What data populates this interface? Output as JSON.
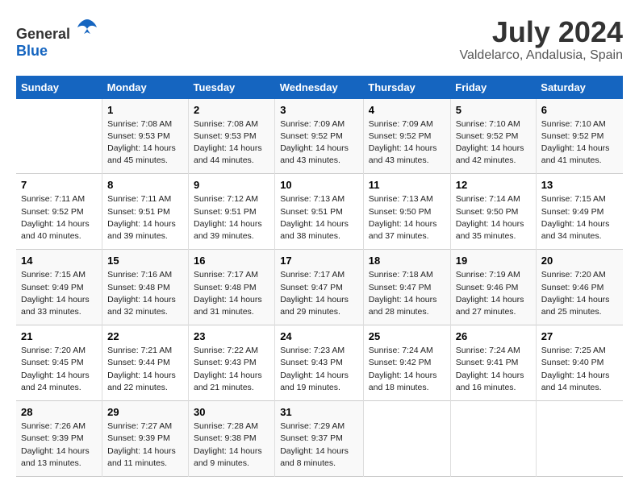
{
  "logo": {
    "text_general": "General",
    "text_blue": "Blue"
  },
  "title": {
    "month": "July 2024",
    "location": "Valdelarco, Andalusia, Spain"
  },
  "days_header": [
    "Sunday",
    "Monday",
    "Tuesday",
    "Wednesday",
    "Thursday",
    "Friday",
    "Saturday"
  ],
  "weeks": [
    [
      {
        "day": "",
        "sunrise": "",
        "sunset": "",
        "daylight": ""
      },
      {
        "day": "1",
        "sunrise": "Sunrise: 7:08 AM",
        "sunset": "Sunset: 9:53 PM",
        "daylight": "Daylight: 14 hours and 45 minutes."
      },
      {
        "day": "2",
        "sunrise": "Sunrise: 7:08 AM",
        "sunset": "Sunset: 9:53 PM",
        "daylight": "Daylight: 14 hours and 44 minutes."
      },
      {
        "day": "3",
        "sunrise": "Sunrise: 7:09 AM",
        "sunset": "Sunset: 9:52 PM",
        "daylight": "Daylight: 14 hours and 43 minutes."
      },
      {
        "day": "4",
        "sunrise": "Sunrise: 7:09 AM",
        "sunset": "Sunset: 9:52 PM",
        "daylight": "Daylight: 14 hours and 43 minutes."
      },
      {
        "day": "5",
        "sunrise": "Sunrise: 7:10 AM",
        "sunset": "Sunset: 9:52 PM",
        "daylight": "Daylight: 14 hours and 42 minutes."
      },
      {
        "day": "6",
        "sunrise": "Sunrise: 7:10 AM",
        "sunset": "Sunset: 9:52 PM",
        "daylight": "Daylight: 14 hours and 41 minutes."
      }
    ],
    [
      {
        "day": "7",
        "sunrise": "Sunrise: 7:11 AM",
        "sunset": "Sunset: 9:52 PM",
        "daylight": "Daylight: 14 hours and 40 minutes."
      },
      {
        "day": "8",
        "sunrise": "Sunrise: 7:11 AM",
        "sunset": "Sunset: 9:51 PM",
        "daylight": "Daylight: 14 hours and 39 minutes."
      },
      {
        "day": "9",
        "sunrise": "Sunrise: 7:12 AM",
        "sunset": "Sunset: 9:51 PM",
        "daylight": "Daylight: 14 hours and 39 minutes."
      },
      {
        "day": "10",
        "sunrise": "Sunrise: 7:13 AM",
        "sunset": "Sunset: 9:51 PM",
        "daylight": "Daylight: 14 hours and 38 minutes."
      },
      {
        "day": "11",
        "sunrise": "Sunrise: 7:13 AM",
        "sunset": "Sunset: 9:50 PM",
        "daylight": "Daylight: 14 hours and 37 minutes."
      },
      {
        "day": "12",
        "sunrise": "Sunrise: 7:14 AM",
        "sunset": "Sunset: 9:50 PM",
        "daylight": "Daylight: 14 hours and 35 minutes."
      },
      {
        "day": "13",
        "sunrise": "Sunrise: 7:15 AM",
        "sunset": "Sunset: 9:49 PM",
        "daylight": "Daylight: 14 hours and 34 minutes."
      }
    ],
    [
      {
        "day": "14",
        "sunrise": "Sunrise: 7:15 AM",
        "sunset": "Sunset: 9:49 PM",
        "daylight": "Daylight: 14 hours and 33 minutes."
      },
      {
        "day": "15",
        "sunrise": "Sunrise: 7:16 AM",
        "sunset": "Sunset: 9:48 PM",
        "daylight": "Daylight: 14 hours and 32 minutes."
      },
      {
        "day": "16",
        "sunrise": "Sunrise: 7:17 AM",
        "sunset": "Sunset: 9:48 PM",
        "daylight": "Daylight: 14 hours and 31 minutes."
      },
      {
        "day": "17",
        "sunrise": "Sunrise: 7:17 AM",
        "sunset": "Sunset: 9:47 PM",
        "daylight": "Daylight: 14 hours and 29 minutes."
      },
      {
        "day": "18",
        "sunrise": "Sunrise: 7:18 AM",
        "sunset": "Sunset: 9:47 PM",
        "daylight": "Daylight: 14 hours and 28 minutes."
      },
      {
        "day": "19",
        "sunrise": "Sunrise: 7:19 AM",
        "sunset": "Sunset: 9:46 PM",
        "daylight": "Daylight: 14 hours and 27 minutes."
      },
      {
        "day": "20",
        "sunrise": "Sunrise: 7:20 AM",
        "sunset": "Sunset: 9:46 PM",
        "daylight": "Daylight: 14 hours and 25 minutes."
      }
    ],
    [
      {
        "day": "21",
        "sunrise": "Sunrise: 7:20 AM",
        "sunset": "Sunset: 9:45 PM",
        "daylight": "Daylight: 14 hours and 24 minutes."
      },
      {
        "day": "22",
        "sunrise": "Sunrise: 7:21 AM",
        "sunset": "Sunset: 9:44 PM",
        "daylight": "Daylight: 14 hours and 22 minutes."
      },
      {
        "day": "23",
        "sunrise": "Sunrise: 7:22 AM",
        "sunset": "Sunset: 9:43 PM",
        "daylight": "Daylight: 14 hours and 21 minutes."
      },
      {
        "day": "24",
        "sunrise": "Sunrise: 7:23 AM",
        "sunset": "Sunset: 9:43 PM",
        "daylight": "Daylight: 14 hours and 19 minutes."
      },
      {
        "day": "25",
        "sunrise": "Sunrise: 7:24 AM",
        "sunset": "Sunset: 9:42 PM",
        "daylight": "Daylight: 14 hours and 18 minutes."
      },
      {
        "day": "26",
        "sunrise": "Sunrise: 7:24 AM",
        "sunset": "Sunset: 9:41 PM",
        "daylight": "Daylight: 14 hours and 16 minutes."
      },
      {
        "day": "27",
        "sunrise": "Sunrise: 7:25 AM",
        "sunset": "Sunset: 9:40 PM",
        "daylight": "Daylight: 14 hours and 14 minutes."
      }
    ],
    [
      {
        "day": "28",
        "sunrise": "Sunrise: 7:26 AM",
        "sunset": "Sunset: 9:39 PM",
        "daylight": "Daylight: 14 hours and 13 minutes."
      },
      {
        "day": "29",
        "sunrise": "Sunrise: 7:27 AM",
        "sunset": "Sunset: 9:39 PM",
        "daylight": "Daylight: 14 hours and 11 minutes."
      },
      {
        "day": "30",
        "sunrise": "Sunrise: 7:28 AM",
        "sunset": "Sunset: 9:38 PM",
        "daylight": "Daylight: 14 hours and 9 minutes."
      },
      {
        "day": "31",
        "sunrise": "Sunrise: 7:29 AM",
        "sunset": "Sunset: 9:37 PM",
        "daylight": "Daylight: 14 hours and 8 minutes."
      },
      {
        "day": "",
        "sunrise": "",
        "sunset": "",
        "daylight": ""
      },
      {
        "day": "",
        "sunrise": "",
        "sunset": "",
        "daylight": ""
      },
      {
        "day": "",
        "sunrise": "",
        "sunset": "",
        "daylight": ""
      }
    ]
  ]
}
